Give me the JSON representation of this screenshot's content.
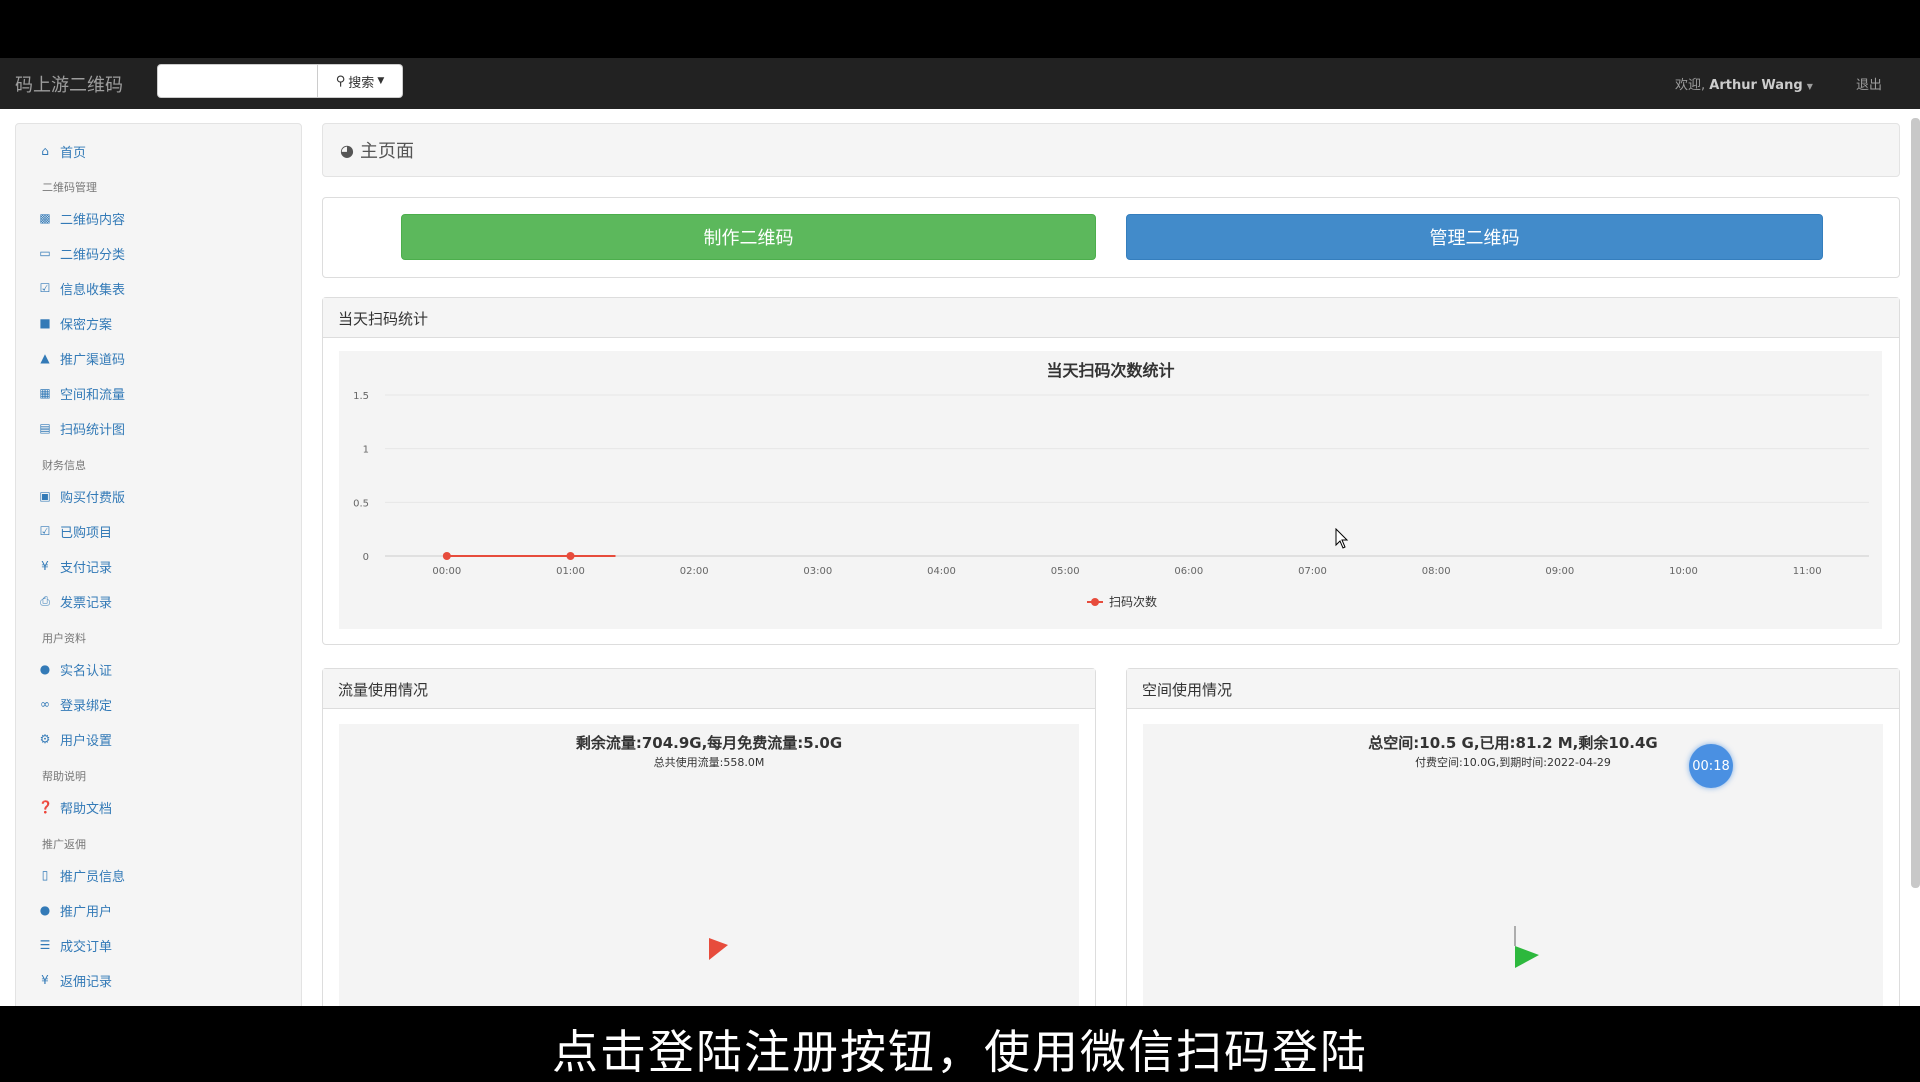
{
  "navbar": {
    "brand": "码上游二维码",
    "search_button": "搜索",
    "welcome_prefix": "欢迎,",
    "username": "Arthur Wang",
    "logout": "退出"
  },
  "sidebar": {
    "home": "首页",
    "groups": [
      {
        "header": "二维码管理",
        "items": [
          {
            "label": "二维码内容",
            "icon": "qrcode-icon"
          },
          {
            "label": "二维码分类",
            "icon": "folder-icon"
          },
          {
            "label": "信息收集表",
            "icon": "checkbox-icon"
          },
          {
            "label": "保密方案",
            "icon": "lock-icon"
          },
          {
            "label": "推广渠道码",
            "icon": "sitemap-icon"
          },
          {
            "label": "空间和流量",
            "icon": "grid-icon"
          },
          {
            "label": "扫码统计图",
            "icon": "bar-chart-icon"
          }
        ]
      },
      {
        "header": "财务信息",
        "items": [
          {
            "label": "购买付费版",
            "icon": "cart-icon"
          },
          {
            "label": "已购项目",
            "icon": "check-square-icon"
          },
          {
            "label": "支付记录",
            "icon": "yen-icon"
          },
          {
            "label": "发票记录",
            "icon": "print-icon"
          }
        ]
      },
      {
        "header": "用户资料",
        "items": [
          {
            "label": "实名认证",
            "icon": "user-icon"
          },
          {
            "label": "登录绑定",
            "icon": "link-icon"
          },
          {
            "label": "用户设置",
            "icon": "cog-icon"
          }
        ]
      },
      {
        "header": "帮助说明",
        "items": [
          {
            "label": "帮助文档",
            "icon": "question-icon"
          }
        ]
      },
      {
        "header": "推广返佣",
        "items": [
          {
            "label": "推广员信息",
            "icon": "file-icon"
          },
          {
            "label": "推广用户",
            "icon": "user-icon"
          },
          {
            "label": "成交订单",
            "icon": "list-icon"
          },
          {
            "label": "返佣记录",
            "icon": "yen-icon"
          }
        ]
      }
    ]
  },
  "main": {
    "breadcrumb": "主页面",
    "btn_make": "制作二维码",
    "btn_manage": "管理二维码",
    "scan_panel_title": "当天扫码统计",
    "traffic_panel_title": "流量使用情况",
    "space_panel_title": "空间使用情况",
    "traffic_title": "剩余流量:704.9G,每月免费流量:5.0G",
    "traffic_sub": "总共使用流量:558.0M",
    "space_title": "总空间:10.5 G,已用:81.2 M,剩余10.4G",
    "space_sub": "付费空间:10.0G,到期时间:2022-04-29"
  },
  "overlay": {
    "timer": "00:18",
    "subtitle": "点击登陆注册按钮，使用微信扫码登陆"
  },
  "colors": {
    "navbar": "#222222",
    "green": "#5cb85c",
    "blue": "#428bca",
    "series": "#e74c3c",
    "pie_green": "#2db83d"
  },
  "chart_data": [
    {
      "type": "line",
      "title": "当天扫码次数统计",
      "x": [
        "00:00",
        "01:00",
        "02:00",
        "03:00",
        "04:00",
        "05:00",
        "06:00",
        "07:00",
        "08:00",
        "09:00",
        "10:00",
        "11:00"
      ],
      "y_ticks": [
        "0",
        "0.5",
        "1",
        "1.5"
      ],
      "ylim": [
        0,
        1.5
      ],
      "series": [
        {
          "name": "扫码次数",
          "values": [
            0,
            0
          ]
        }
      ],
      "legend": "bottom",
      "grid": true
    },
    {
      "type": "pie",
      "title": "剩余流量:704.9G,每月免费流量:5.0G",
      "subtitle": "总共使用流量:558.0M"
    },
    {
      "type": "pie",
      "title": "总空间:10.5 G,已用:81.2 M,剩余10.4G",
      "subtitle": "付费空间:10.0G,到期时间:2022-04-29"
    }
  ]
}
